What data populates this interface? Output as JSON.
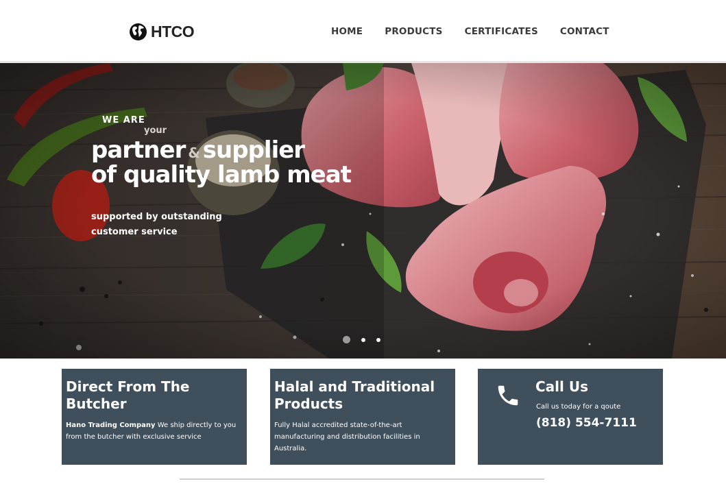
{
  "brand": {
    "name": "HTCO",
    "logo_icon": "globe-icon"
  },
  "nav": {
    "items": [
      "HOME",
      "PRODUCTS",
      "CERTIFICATES",
      "CONTACT"
    ]
  },
  "hero": {
    "eyebrow": "WE ARE",
    "small_word": "your",
    "headline_part1": "partner",
    "amp": "&",
    "headline_part2": "supplier",
    "headline_line2": "of quality lamb meat",
    "subtext": "supported by outstanding customer service",
    "slider": {
      "slide_count": 3,
      "active_index": 0
    }
  },
  "cards": [
    {
      "title": "Direct From The Butcher",
      "body_bold": "Hano Trading Company",
      "body": " We ship directly to you from the butcher with exclusive service"
    },
    {
      "title": "Halal and Traditional Products",
      "body": "Fully Halal accredited state-of-the-art manufacturing and distribution facilities in Australia."
    },
    {
      "icon": "phone-icon",
      "title": "Call Us",
      "subtitle": "Call us today for a qoute",
      "phone": "(818) 554-7111"
    }
  ],
  "colors": {
    "card_bg": "#3f4f5b",
    "nav_text": "#3a3a3a",
    "white": "#ffffff"
  }
}
